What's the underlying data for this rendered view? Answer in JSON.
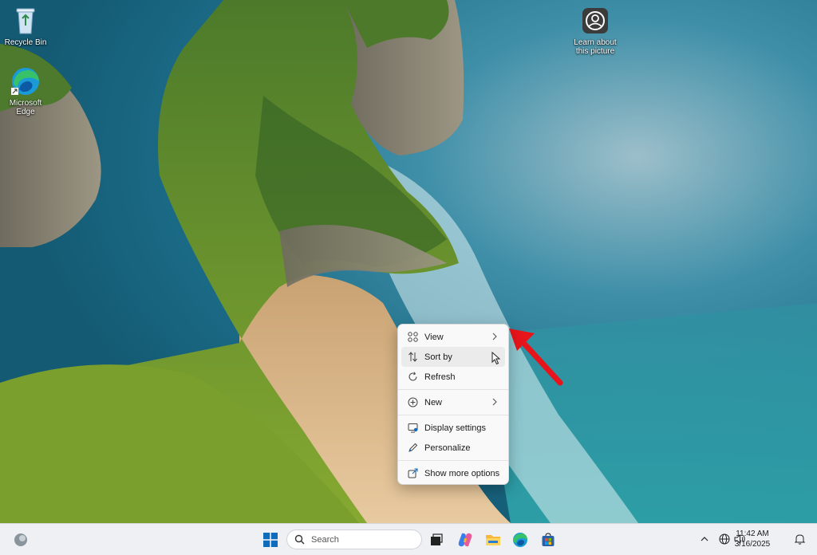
{
  "desktop": {
    "icons": [
      {
        "label": "Recycle Bin",
        "icon": "recycle-bin-icon"
      },
      {
        "label": "Microsoft Edge",
        "icon": "edge-icon"
      },
      {
        "label": "Learn about this picture",
        "icon": "camera-icon"
      }
    ]
  },
  "context_menu": {
    "items": [
      {
        "label": "View",
        "icon": "grid-icon",
        "has_submenu": true
      },
      {
        "label": "Sort by",
        "icon": "sort-icon",
        "has_submenu": false
      },
      {
        "label": "Refresh",
        "icon": "refresh-icon",
        "has_submenu": false
      },
      {
        "label": "New",
        "icon": "plus-circle-icon",
        "has_submenu": true
      },
      {
        "label": "Display settings",
        "icon": "display-icon",
        "has_submenu": false
      },
      {
        "label": "Personalize",
        "icon": "pen-icon",
        "has_submenu": false
      },
      {
        "label": "Show more options",
        "icon": "share-icon",
        "has_submenu": false
      }
    ]
  },
  "taskbar": {
    "search_placeholder": "Search",
    "apps": [
      "start-icon",
      "task-view-icon",
      "copilot-icon",
      "file-explorer-icon",
      "edge-icon",
      "store-icon"
    ],
    "clock": {
      "time": "11:42 AM",
      "date": "3/16/2025"
    }
  },
  "colors": {
    "annotation_arrow": "#e8141b",
    "menu_background": "#f9f9f9",
    "taskbar_background": "#eef0f3",
    "start_blue": "#0f6cbd"
  }
}
